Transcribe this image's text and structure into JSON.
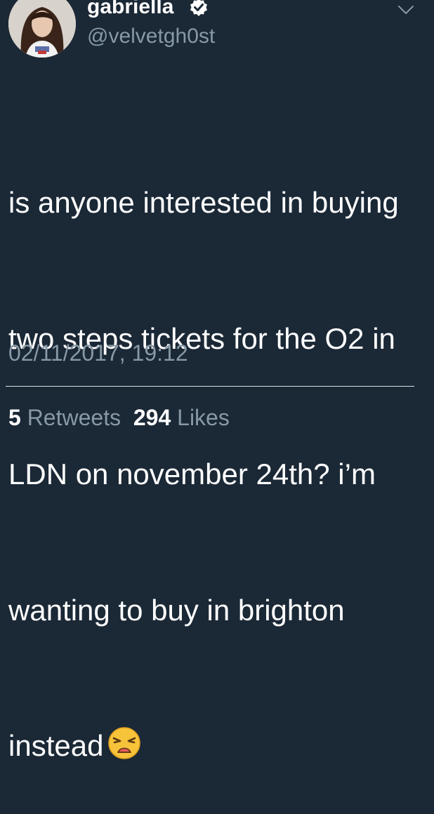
{
  "user": {
    "display_name": "gabriella",
    "handle": "@velvetgh0st",
    "verified": true,
    "avatar_icon": "profile-photo"
  },
  "tweet": {
    "lines": [
      "is anyone interested in buying",
      "two steps tickets for the O2 in",
      "LDN on november 24th? i’m",
      "wanting to buy in brighton",
      "instead"
    ],
    "emoji": "weary-face-icon",
    "timestamp": "02/11/2017, 19:12"
  },
  "stats": {
    "retweets_count": "5",
    "retweets_label": "Retweets",
    "likes_count": "294",
    "likes_label": "Likes"
  },
  "colors": {
    "background": "#1b2836",
    "primary_text": "#ffffff",
    "secondary_text": "#8899a6"
  }
}
